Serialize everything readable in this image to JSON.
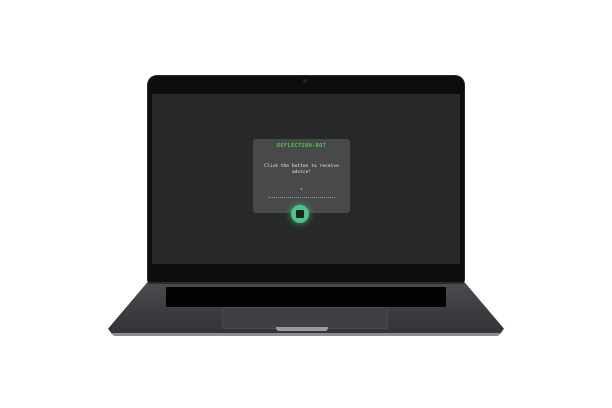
{
  "app": {
    "title": "REFLECTION-BOT",
    "advice_text": "Click the button to receive advice!",
    "quote_mark": "\"",
    "dice_button_icon": "dice-icon"
  },
  "colors": {
    "accent": "#4cc04e",
    "button": "#4cc38b",
    "card": "#484a49",
    "screen_bg": "#282a2a"
  }
}
